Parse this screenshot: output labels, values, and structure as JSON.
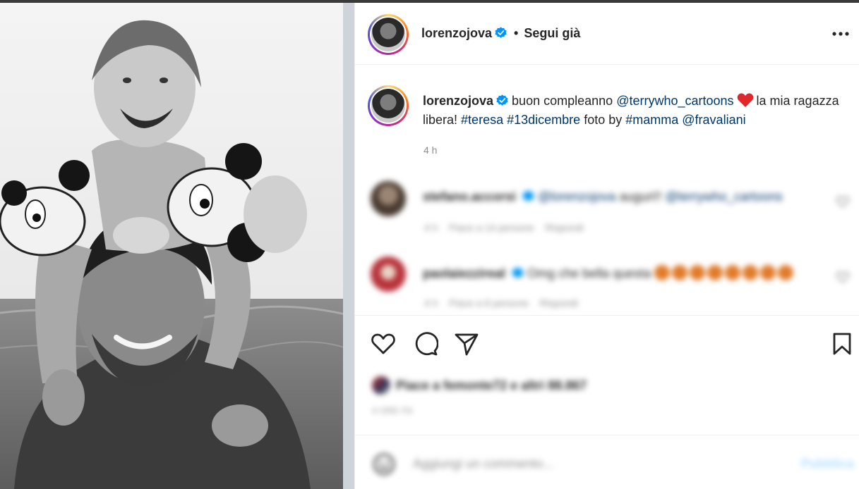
{
  "post": {
    "username": "lorenzojova",
    "follow_status": "Segui già",
    "caption": {
      "username": "lorenzojova",
      "text_1": "buon compleanno",
      "mention_1": "@terrywho_cartoons",
      "text_2": "la mia ragazza libera!",
      "hashtag_1": "#teresa",
      "hashtag_2": "#13dicembre",
      "text_3": "foto by",
      "hashtag_3": "#mamma",
      "mention_2": "@fravaliani"
    },
    "time_ago": "4 h"
  },
  "comments": [
    {
      "username": "stefano.accorsi",
      "mention": "@lorenzojova",
      "text": "auguri!!",
      "mention_2": "@terrywho_cartoons",
      "meta_time": "4 h",
      "meta_likes": "Piace a 14 persone",
      "meta_reply": "Rispondi",
      "avatar_color": "#5a4a3f"
    },
    {
      "username": "paolaiezzireal",
      "text": "Omg che bella questa",
      "meta_time": "4 h",
      "meta_likes": "Piace a 8 persone",
      "meta_reply": "Rispondi",
      "avatar_color": "#b8343c"
    }
  ],
  "actions": {
    "likes_text": "Piace a femonte72 e altri 88.867",
    "date": "4 ORE FA"
  },
  "add_comment": {
    "placeholder": "Aggiungi un commento...",
    "publish": "Pubblica"
  },
  "icons": {
    "like": "heart-outline-icon",
    "comment": "comment-bubble-icon",
    "share": "paper-plane-icon",
    "save": "bookmark-icon",
    "more": "more-options-icon",
    "verified": "verified-badge-icon",
    "emoji": "emoji-smiley-icon"
  },
  "colors": {
    "verified": "#0095f6",
    "link": "#00376b",
    "heart": "#e0272b",
    "publish": "#b2dffc"
  }
}
